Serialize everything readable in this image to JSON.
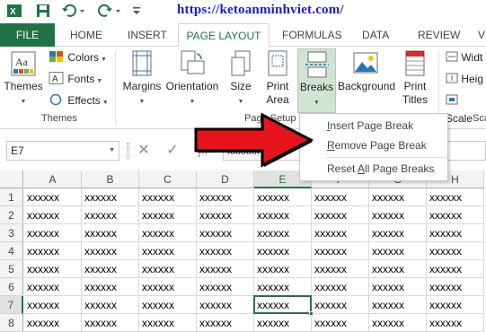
{
  "watermark_url": "https://ketoanminhviet.com/",
  "tabs": [
    {
      "label": "FILE",
      "active": false
    },
    {
      "label": "HOME",
      "active": false
    },
    {
      "label": "INSERT",
      "active": false
    },
    {
      "label": "PAGE LAYOUT",
      "active": true
    },
    {
      "label": "FORMULAS",
      "active": false
    },
    {
      "label": "DATA",
      "active": false
    },
    {
      "label": "REVIEW",
      "active": false
    },
    {
      "label": "V",
      "active": false
    }
  ],
  "ribbon": {
    "themes": {
      "label": "Themes",
      "group_label": "Themes"
    },
    "colors": "Colors",
    "fonts": "Fonts",
    "effects": "Effects",
    "margins": "Margins",
    "orientation": "Orientation",
    "size": "Size",
    "print_area": {
      "line1": "Print",
      "line2": "Area"
    },
    "breaks": "Breaks",
    "background": "Background",
    "print_titles": {
      "line1": "Print",
      "line2": "Titles"
    },
    "page_setup_label": "Page Setup",
    "width": "Widt",
    "height": "Heig",
    "scale": "Scale",
    "scale_group_label": "Sca"
  },
  "breaks_menu": {
    "items": [
      {
        "label": "Insert Page Break",
        "mnemonic": "I"
      },
      {
        "label": "Remove Page Break",
        "mnemonic": "R"
      },
      {
        "label": "Reset All Page Breaks",
        "mnemonic": "A"
      }
    ]
  },
  "formula_bar": {
    "name_box": "E7",
    "cancel": "✕",
    "enter": "✓",
    "fx": "fx",
    "content": "xxxxxx"
  },
  "sheet": {
    "columns": [
      "A",
      "B",
      "C",
      "D",
      "E",
      "F",
      "G",
      "H"
    ],
    "rows": [
      "1",
      "2",
      "3",
      "4",
      "5",
      "6",
      "7",
      "8"
    ],
    "cell_value": "xxxxxx",
    "active_cell": "E7"
  },
  "colors": {
    "excel_green": "#217346",
    "arrow_red": "#e8141b",
    "url_blue": "#1a1ad6"
  }
}
